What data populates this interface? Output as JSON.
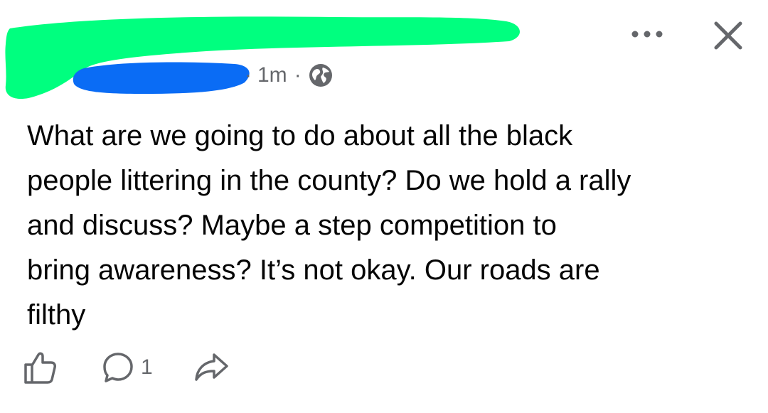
{
  "post": {
    "time": "1m",
    "separator": "·",
    "text": "What are we going to do about all the black\npeople littering in the county? Do we hold a rally\nand discuss? Maybe a step competition to\nbring awareness? It’s not okay. Our roads are\nfilthy",
    "comment_count": "1",
    "audience_icon": "globe-icon"
  },
  "header": {
    "more_icon": "more-icon",
    "close_icon": "close-icon"
  },
  "redaction_colors": {
    "name": "#00ff7f",
    "secondary": "#0a6cf5"
  },
  "colors": {
    "text": "#050505",
    "secondary_text": "#65676b",
    "icon": "#65676b"
  }
}
